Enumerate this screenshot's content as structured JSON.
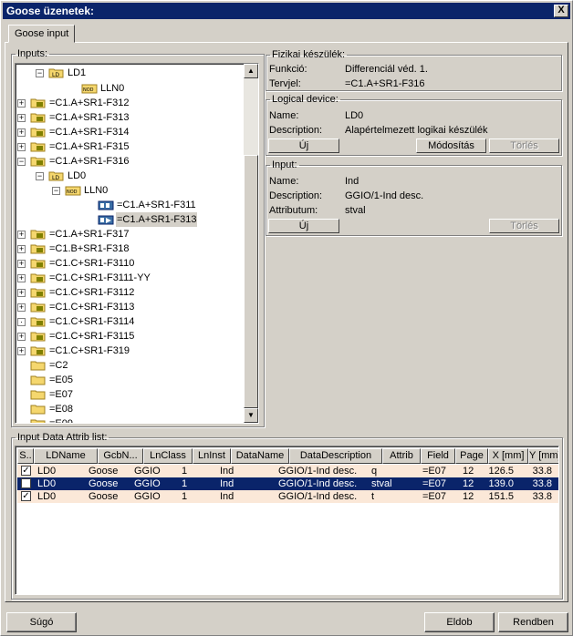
{
  "window": {
    "title": "Goose üzenetek:",
    "close": "X"
  },
  "tab": {
    "label": "Goose input"
  },
  "inputs": {
    "legend": "Inputs:",
    "tree": [
      {
        "label": "LD1",
        "icon": "ld-icon"
      },
      {
        "label": "LLN0",
        "icon": "node-icon"
      },
      {
        "label": "=C1.A+SR1-F312",
        "icon": "ied-icon"
      },
      {
        "label": "=C1.A+SR1-F313",
        "icon": "ied-icon"
      },
      {
        "label": "=C1.A+SR1-F314",
        "icon": "ied-icon"
      },
      {
        "label": "=C1.A+SR1-F315",
        "icon": "ied-icon"
      },
      {
        "label": "=C1.A+SR1-F316",
        "icon": "ied-icon"
      },
      {
        "label": "LD0",
        "icon": "ld-icon"
      },
      {
        "label": "LLN0",
        "icon": "node-icon"
      },
      {
        "label": "=C1.A+SR1-F311",
        "icon": "goose-icon"
      },
      {
        "label": "=C1.A+SR1-F313",
        "icon": "goose-link-icon"
      },
      {
        "label": "=C1.A+SR1-F317",
        "icon": "ied-icon"
      },
      {
        "label": "=C1.B+SR1-F318",
        "icon": "ied-icon"
      },
      {
        "label": "=C1.C+SR1-F3110",
        "icon": "ied-icon"
      },
      {
        "label": "=C1.C+SR1-F3111-YY",
        "icon": "ied-icon"
      },
      {
        "label": "=C1.C+SR1-F3112",
        "icon": "ied-icon"
      },
      {
        "label": "=C1.C+SR1-F3113",
        "icon": "ied-icon"
      },
      {
        "label": "=C1.C+SR1-F3114",
        "icon": "ied-icon"
      },
      {
        "label": "=C1.C+SR1-F3115",
        "icon": "ied-icon"
      },
      {
        "label": "=C1.C+SR1-F319",
        "icon": "ied-icon"
      },
      {
        "label": "=C2",
        "icon": "folder-icon"
      },
      {
        "label": "=E05",
        "icon": "folder-icon"
      },
      {
        "label": "=E07",
        "icon": "folder-icon"
      },
      {
        "label": "=E08",
        "icon": "folder-icon"
      },
      {
        "label": "=E09",
        "icon": "folder-icon"
      }
    ]
  },
  "fizikai": {
    "legend": "Fizikai készülék:",
    "funkcio_label": "Funkció:",
    "funkcio_value": "Differenciál véd. 1.",
    "tervjel_label": "Tervjel:",
    "tervjel_value": "=C1.A+SR1-F316"
  },
  "logical": {
    "legend": "Logical device:",
    "name_label": "Name:",
    "name_value": "LD0",
    "desc_label": "Description:",
    "desc_value": "Alapértelmezett logikai készülék",
    "btn_new": "Új",
    "btn_modify": "Módosítás",
    "btn_delete": "Törlés"
  },
  "input": {
    "legend": "Input:",
    "name_label": "Name:",
    "name_value": "Ind",
    "desc_label": "Description:",
    "desc_value": "GGIO/1-Ind desc.",
    "attr_label": "Attributum:",
    "attr_value": "stval",
    "btn_new": "Új",
    "btn_delete": "Törlés"
  },
  "list": {
    "legend": "Input Data Attrib list:",
    "columns": [
      "S..",
      "LDName",
      "GcbN...",
      "LnClass",
      "LnInst",
      "DataName",
      "DataDescription",
      "Attrib",
      "Field",
      "Page",
      "X [mm]",
      "Y [mm]"
    ],
    "rows": [
      {
        "checked": "✓",
        "cells": [
          "LD0",
          "Goose",
          "GGIO",
          "1",
          "Ind",
          "GGIO/1-Ind desc.",
          "q",
          "=E07",
          "12.",
          "126.5",
          "33.8"
        ]
      },
      {
        "checked": "✓",
        "cells": [
          "LD0",
          "Goose",
          "GGIO",
          "1",
          "Ind",
          "GGIO/1-Ind desc.",
          "stval",
          "=E07",
          "12.",
          "139.0",
          "33.8"
        ]
      },
      {
        "checked": "✓",
        "cells": [
          "LD0",
          "Goose",
          "GGIO",
          "1",
          "Ind",
          "GGIO/1-Ind desc.",
          "t",
          "=E07",
          "12.",
          "151.5",
          "33.8"
        ]
      }
    ],
    "row_colors": {
      "odd": "#fbe8d8",
      "selected": "#0a246a"
    }
  },
  "footer": {
    "help": "Súgó",
    "discard": "Eldob",
    "ok": "Rendben"
  }
}
